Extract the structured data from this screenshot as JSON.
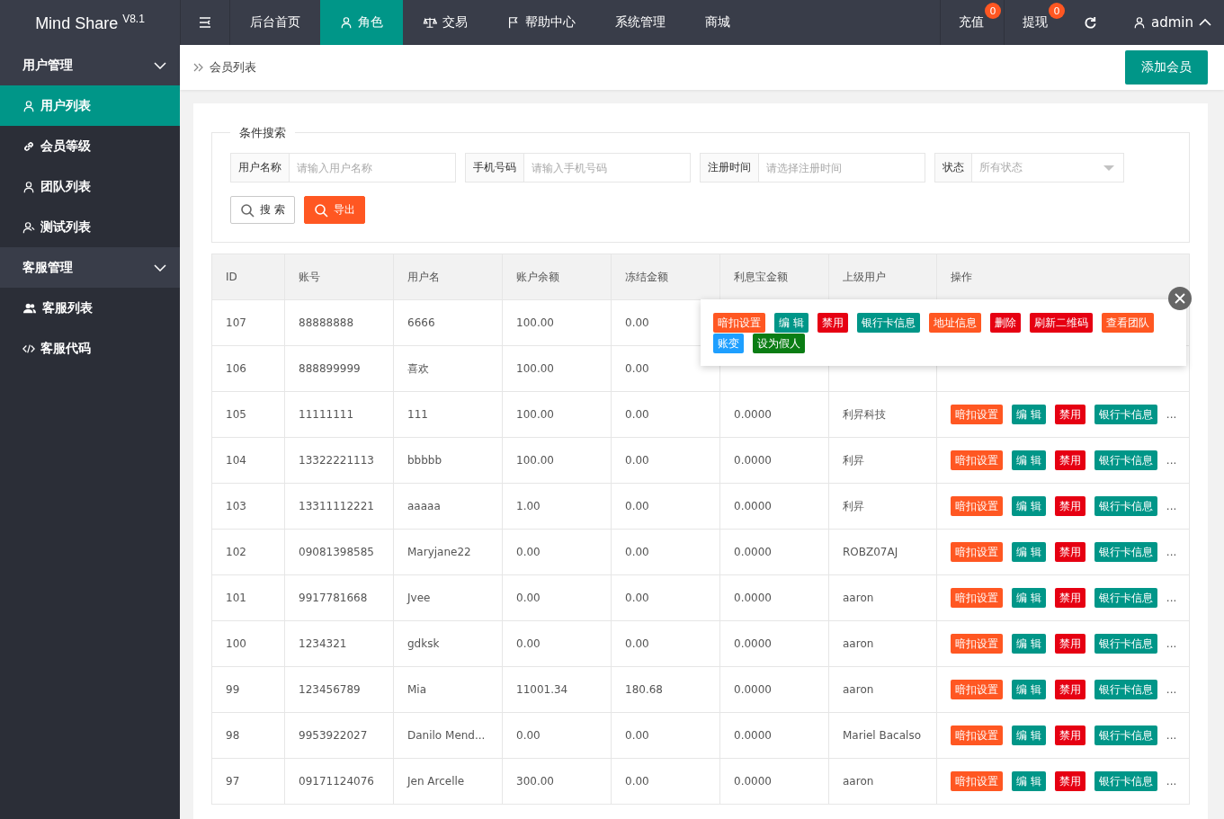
{
  "logo": "Mind Share $^{V8.1}$",
  "nav": [
    {
      "label": "后台首页",
      "selected": false
    },
    {
      "label": "角色",
      "selected": true
    },
    {
      "label": "交易",
      "selected": false
    },
    {
      "label": "帮助中心",
      "selected": false
    },
    {
      "label": "系统管理",
      "selected": false
    },
    {
      "label": "商城",
      "selected": false
    }
  ],
  "top_right": [
    {
      "label": "充值",
      "badge": "0"
    },
    {
      "label": "提现",
      "badge": "0"
    }
  ],
  "user": {
    "name": "admin",
    "expanded": true
  },
  "sidebar": [
    {
      "label": "用户管理",
      "expanded": true,
      "children": [
        {
          "label": "用户列表",
          "selected": true
        },
        {
          "label": "会员等级",
          "selected": false
        },
        {
          "label": "团队列表",
          "selected": false
        },
        {
          "label": "测试列表",
          "selected": false
        }
      ]
    },
    {
      "label": "客服管理",
      "expanded": true,
      "children": [
        {
          "label": "客服列表",
          "selected": false
        },
        {
          "label": "客服代码",
          "selected": false
        }
      ]
    }
  ],
  "breadcrumb": "会员列表",
  "add_button": "添加会员",
  "search": {
    "legend": "条件搜索",
    "fields": [
      {
        "label": "用户名称",
        "placeholder": "请输入用户名称",
        "kind": "input"
      },
      {
        "label": "手机号码",
        "placeholder": "请输入手机号码",
        "kind": "input"
      },
      {
        "label": "注册时间",
        "placeholder": "请选择注册时间",
        "kind": "input"
      },
      {
        "label": "状态",
        "placeholder": "所有状态",
        "kind": "select"
      }
    ],
    "buttons": [
      {
        "label": "搜 索",
        "kind": "plain"
      },
      {
        "label": "导出",
        "kind": "primary"
      }
    ]
  },
  "table": {
    "columns": [
      "ID",
      "账号",
      "用户名",
      "账户余额",
      "冻结金额",
      "利息宝金额",
      "上级用户",
      "操作"
    ],
    "more": "...",
    "rows": [
      {
        "cells": [
          "107",
          "88888888",
          "6666",
          "100.00",
          "0.00"
        ],
        "actions": []
      },
      {
        "cells": [
          "106",
          "888899999",
          "喜欢",
          "100.00",
          "0.00"
        ],
        "actions": []
      },
      {
        "cells": [
          "105",
          "11111111",
          "111",
          "100.00",
          "0.00",
          "0.0000",
          "利昇科技"
        ],
        "actions": [
          {
            "label": "暗扣设置",
            "color": "#ff5722"
          },
          {
            "label": "编 辑",
            "color": "#009688"
          },
          {
            "label": "禁用",
            "color": "#e60012"
          },
          {
            "label": "银行卡信息",
            "color": "#009688"
          }
        ]
      },
      {
        "cells": [
          "104",
          "13322221113",
          "bbbbb",
          "100.00",
          "0.00",
          "0.0000",
          "利昇"
        ],
        "actions": [
          {
            "label": "暗扣设置",
            "color": "#ff5722"
          },
          {
            "label": "编 辑",
            "color": "#009688"
          },
          {
            "label": "禁用",
            "color": "#e60012"
          },
          {
            "label": "银行卡信息",
            "color": "#009688"
          }
        ]
      },
      {
        "cells": [
          "103",
          "13311112221",
          "aaaaa",
          "1.00",
          "0.00",
          "0.0000",
          "利昇"
        ],
        "actions": [
          {
            "label": "暗扣设置",
            "color": "#ff5722"
          },
          {
            "label": "编 辑",
            "color": "#009688"
          },
          {
            "label": "禁用",
            "color": "#e60012"
          },
          {
            "label": "银行卡信息",
            "color": "#009688"
          }
        ]
      },
      {
        "cells": [
          "102",
          "09081398585",
          "Maryjane22",
          "0.00",
          "0.00",
          "0.0000",
          "ROBZ07AJ"
        ],
        "actions": [
          {
            "label": "暗扣设置",
            "color": "#ff5722"
          },
          {
            "label": "编 辑",
            "color": "#009688"
          },
          {
            "label": "禁用",
            "color": "#e60012"
          },
          {
            "label": "银行卡信息",
            "color": "#009688"
          }
        ]
      },
      {
        "cells": [
          "101",
          "9917781668",
          "Jvee",
          "0.00",
          "0.00",
          "0.0000",
          "aaron"
        ],
        "actions": [
          {
            "label": "暗扣设置",
            "color": "#ff5722"
          },
          {
            "label": "编 辑",
            "color": "#009688"
          },
          {
            "label": "禁用",
            "color": "#e60012"
          },
          {
            "label": "银行卡信息",
            "color": "#009688"
          }
        ]
      },
      {
        "cells": [
          "100",
          "1234321",
          "gdksk",
          "0.00",
          "0.00",
          "0.0000",
          "aaron"
        ],
        "actions": [
          {
            "label": "暗扣设置",
            "color": "#ff5722"
          },
          {
            "label": "编 辑",
            "color": "#009688"
          },
          {
            "label": "禁用",
            "color": "#e60012"
          },
          {
            "label": "银行卡信息",
            "color": "#009688"
          }
        ]
      },
      {
        "cells": [
          "99",
          "123456789",
          "Mia",
          "11001.34",
          "180.68",
          "0.0000",
          "aaron"
        ],
        "actions": [
          {
            "label": "暗扣设置",
            "color": "#ff5722"
          },
          {
            "label": "编 辑",
            "color": "#009688"
          },
          {
            "label": "禁用",
            "color": "#e60012"
          },
          {
            "label": "银行卡信息",
            "color": "#009688"
          }
        ]
      },
      {
        "cells": [
          "98",
          "9953922027",
          "Danilo Mend...",
          "0.00",
          "0.00",
          "0.0000",
          "Mariel Bacalso"
        ],
        "actions": [
          {
            "label": "暗扣设置",
            "color": "#ff5722"
          },
          {
            "label": "编 辑",
            "color": "#009688"
          },
          {
            "label": "禁用",
            "color": "#e60012"
          },
          {
            "label": "银行卡信息",
            "color": "#009688"
          }
        ]
      },
      {
        "cells": [
          "97",
          "09171124076",
          "Jen Arcelle",
          "300.00",
          "0.00",
          "0.0000",
          "aaron"
        ],
        "actions": [
          {
            "label": "暗扣设置",
            "color": "#ff5722"
          },
          {
            "label": "编 辑",
            "color": "#009688"
          },
          {
            "label": "禁用",
            "color": "#e60012"
          },
          {
            "label": "银行卡信息",
            "color": "#009688"
          }
        ]
      }
    ]
  },
  "popup": {
    "actions": [
      {
        "label": "暗扣设置",
        "color": "#ff5722"
      },
      {
        "label": "编 辑",
        "color": "#009688"
      },
      {
        "label": "禁用",
        "color": "#e60012"
      },
      {
        "label": "银行卡信息",
        "color": "#009688"
      },
      {
        "label": "地址信息",
        "color": "#ff5722"
      },
      {
        "label": "删除",
        "color": "#e60012"
      },
      {
        "label": "刷新二维码",
        "color": "#e60012"
      },
      {
        "label": "查看团队",
        "color": "#ff5722"
      },
      {
        "label": "账变",
        "color": "#1e9fff"
      },
      {
        "label": "设为假人",
        "color": "#0a7d14"
      }
    ]
  }
}
